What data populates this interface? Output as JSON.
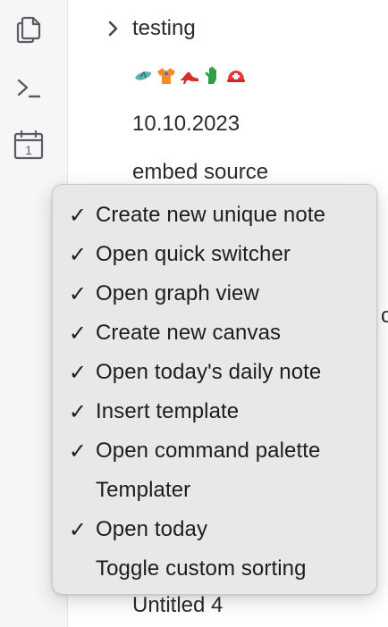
{
  "ribbon": {
    "buttons": [
      {
        "icon": "copy-files-icon"
      },
      {
        "icon": "terminal-icon"
      },
      {
        "icon": "calendar-icon",
        "day": "1"
      }
    ]
  },
  "tree": {
    "folder": {
      "label": "testing",
      "icon": "chevron-right-icon"
    },
    "emoji_note": {
      "icons": [
        "flip-flop-icon",
        "shirt-icon",
        "high-heel-icon",
        "glove-icon",
        "rescue-helmet-icon"
      ]
    },
    "date_note": {
      "label": "10.10.2023"
    },
    "embed_note": {
      "label": "embed source"
    },
    "partial_glyph": "c",
    "last_note": {
      "label": "Untitled 4"
    }
  },
  "menu": {
    "items": [
      {
        "label": "Create new unique note",
        "checked": true,
        "check": "✓"
      },
      {
        "label": "Open quick switcher",
        "checked": true,
        "check": "✓"
      },
      {
        "label": "Open graph view",
        "checked": true,
        "check": "✓"
      },
      {
        "label": "Create new canvas",
        "checked": true,
        "check": "✓"
      },
      {
        "label": "Open today's daily note",
        "checked": true,
        "check": "✓"
      },
      {
        "label": "Insert template",
        "checked": true,
        "check": "✓"
      },
      {
        "label": "Open command palette",
        "checked": true,
        "check": "✓"
      },
      {
        "label": "Templater",
        "checked": false,
        "check": ""
      },
      {
        "label": "Open today",
        "checked": true,
        "check": "✓"
      },
      {
        "label": "Toggle custom sorting",
        "checked": false,
        "check": ""
      }
    ]
  }
}
